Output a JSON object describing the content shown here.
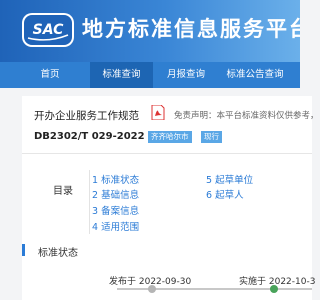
{
  "header": {
    "logo_text": "SAC",
    "site_title": "地方标准信息服务平台"
  },
  "nav": {
    "items": [
      {
        "label": "首页",
        "active": false
      },
      {
        "label": "标准查询",
        "active": true
      },
      {
        "label": "月报查询",
        "active": false
      },
      {
        "label": "标准公告查询",
        "active": false
      }
    ]
  },
  "document": {
    "title": "开办企业服务工作规范",
    "pdf_icon": "pdf-icon",
    "disclaimer": "免责声明：本平台标准资料仅供参考，",
    "code": "DB2302/T 029-2022",
    "region_tag": "齐齐哈尔市",
    "status_tag": "现行",
    "tag_color": "#5aa7e6"
  },
  "toc": {
    "label": "目录",
    "items": [
      "1 标准状态",
      "2 基础信息",
      "3 备案信息",
      "4 适用范围",
      "5 起草单位",
      "6 起草人"
    ]
  },
  "status_section": {
    "title": "标准状态",
    "publish_label": "发布于 2022-09-30",
    "implement_label": "实施于 2022-10-3"
  },
  "colors": {
    "accent": "#2b7bd6",
    "nav_bg": "#2f7fd1",
    "nav_active": "#1d65b3",
    "timeline_active": "#49a35a"
  }
}
